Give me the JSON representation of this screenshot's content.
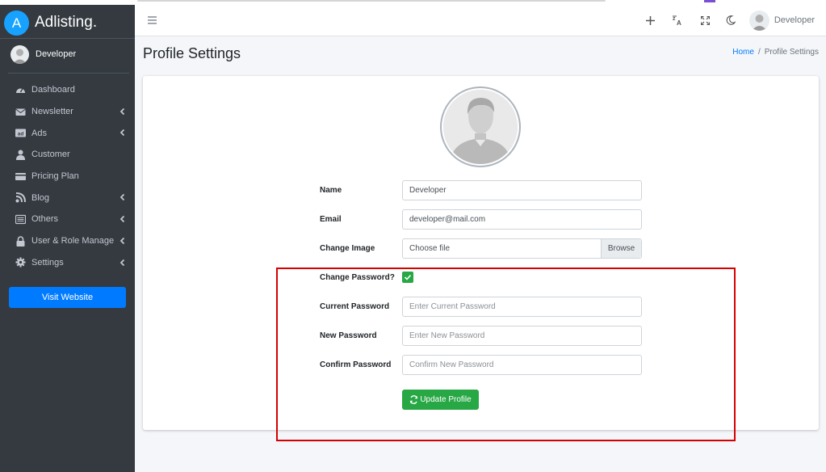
{
  "brand": {
    "logo_letter": "A",
    "name": "Adlisting."
  },
  "sidebar": {
    "user": "Developer",
    "items": [
      {
        "label": "Dashboard",
        "icon": "gauge-icon",
        "chevron": false
      },
      {
        "label": "Newsletter",
        "icon": "envelope-icon",
        "chevron": true
      },
      {
        "label": "Ads",
        "icon": "ad-icon",
        "chevron": true
      },
      {
        "label": "Customer",
        "icon": "user-icon",
        "chevron": false
      },
      {
        "label": "Pricing Plan",
        "icon": "credit-card-icon",
        "chevron": false
      },
      {
        "label": "Blog",
        "icon": "blog-icon",
        "chevron": true
      },
      {
        "label": "Others",
        "icon": "list-icon",
        "chevron": true
      },
      {
        "label": "User & Role Manage",
        "icon": "lock-icon",
        "chevron": true
      },
      {
        "label": "Settings",
        "icon": "gear-icon",
        "chevron": true
      }
    ],
    "visit_button": "Visit Website"
  },
  "navbar": {
    "user_name": "Developer"
  },
  "page": {
    "title": "Profile Settings",
    "breadcrumb": {
      "home": "Home",
      "sep": "/",
      "current": "Profile Settings"
    }
  },
  "form": {
    "name_label": "Name",
    "name_value": "Developer",
    "email_label": "Email",
    "email_value": "developer@mail.com",
    "image_label": "Change Image",
    "image_value": "Choose file",
    "browse_label": "Browse",
    "change_password_label": "Change Password?",
    "current_password_label": "Current Password",
    "current_password_placeholder": "Enter Current Password",
    "new_password_label": "New Password",
    "new_password_placeholder": "Enter New Password",
    "confirm_password_label": "Confirm Password",
    "confirm_password_placeholder": "Confirm New Password",
    "submit_label": "Update Profile"
  },
  "colors": {
    "sidebar_bg": "#343a40",
    "primary": "#007bff",
    "success": "#28a745",
    "highlight_border": "#d60000"
  }
}
